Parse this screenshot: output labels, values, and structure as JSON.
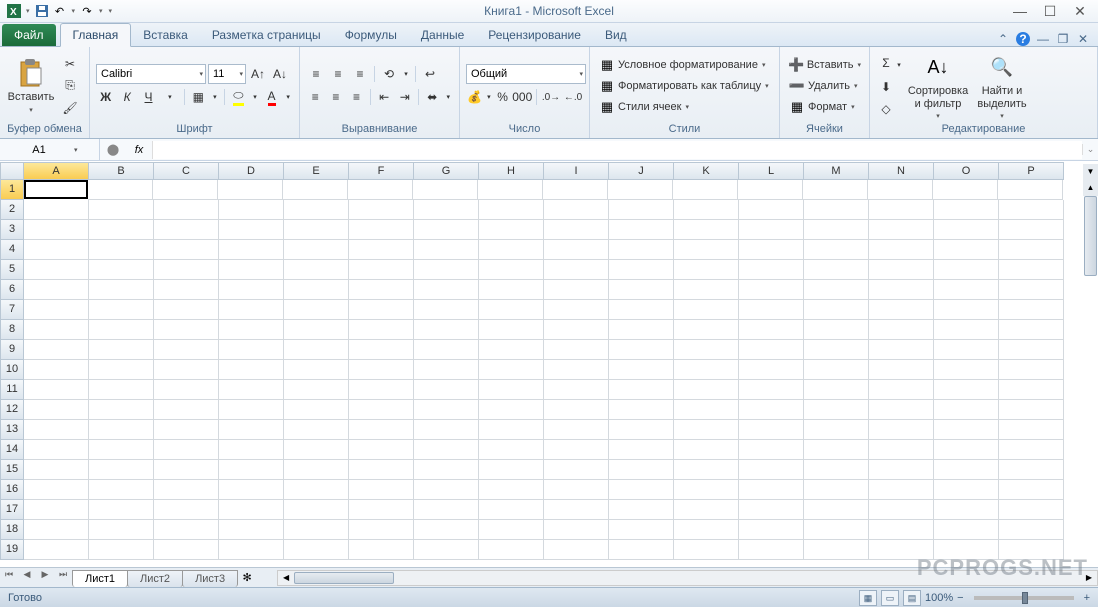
{
  "title": "Книга1 - Microsoft Excel",
  "file_tab": "Файл",
  "tabs": [
    "Главная",
    "Вставка",
    "Разметка страницы",
    "Формулы",
    "Данные",
    "Рецензирование",
    "Вид"
  ],
  "active_tab": 0,
  "clipboard": {
    "paste": "Вставить",
    "label": "Буфер обмена"
  },
  "font": {
    "name": "Calibri",
    "size": "11",
    "bold": "Ж",
    "italic": "К",
    "underline": "Ч",
    "label": "Шрифт"
  },
  "alignment": {
    "label": "Выравнивание"
  },
  "number": {
    "format": "Общий",
    "label": "Число"
  },
  "styles": {
    "cond": "Условное форматирование",
    "table": "Форматировать как таблицу",
    "cell": "Стили ячеек",
    "label": "Стили"
  },
  "cells": {
    "insert": "Вставить",
    "delete": "Удалить",
    "format": "Формат",
    "label": "Ячейки"
  },
  "editing": {
    "sort": "Сортировка и фильтр",
    "find": "Найти и выделить",
    "label": "Редактирование"
  },
  "namebox": "A1",
  "fx": "",
  "columns": [
    "A",
    "B",
    "C",
    "D",
    "E",
    "F",
    "G",
    "H",
    "I",
    "J",
    "K",
    "L",
    "M",
    "N",
    "O",
    "P"
  ],
  "rows": [
    "1",
    "2",
    "3",
    "4",
    "5",
    "6",
    "7",
    "8",
    "9",
    "10",
    "11",
    "12",
    "13",
    "14",
    "15",
    "16",
    "17",
    "18",
    "19"
  ],
  "sheets": [
    "Лист1",
    "Лист2",
    "Лист3"
  ],
  "active_sheet": 0,
  "status": "Готово",
  "zoom": "100%",
  "watermark": "PCPROGS.NET"
}
